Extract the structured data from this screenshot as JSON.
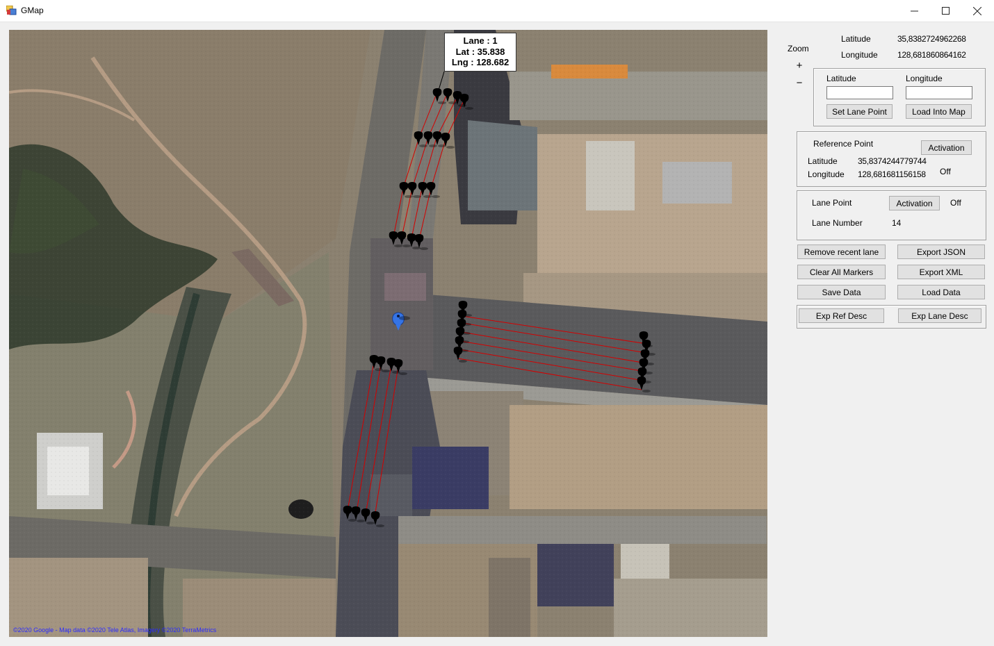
{
  "window": {
    "title": "GMap",
    "minimize_icon": "minimize-icon",
    "maximize_icon": "maximize-icon",
    "close_icon": "close-icon"
  },
  "map": {
    "copyright": "©2020 Google - Map data ©2020 Tele Atlas, Imagery ©2020 TerraMetrics",
    "tooltip": {
      "lane_line": "Lane : 1",
      "lat_line": "Lat : 35.838",
      "lng_line": "Lng : 128.682"
    },
    "marker_color": "#000000",
    "lane_line_color": "#d40000",
    "reference_marker_color": "#2f6fe0"
  },
  "panel": {
    "zoom_label": "Zoom",
    "zoom_in": "+",
    "zoom_out": "−",
    "current": {
      "latitude_label": "Latitude",
      "latitude_value": "35,8382724962268",
      "longitude_label": "Longitude",
      "longitude_value": "128,681860864162"
    },
    "input_group": {
      "latitude_label": "Latitude",
      "latitude_value": "",
      "longitude_label": "Longitude",
      "longitude_value": "",
      "set_lane_point": "Set Lane Point",
      "load_into_map": "Load Into Map"
    },
    "reference": {
      "title": "Reference Point",
      "activation": "Activation",
      "latitude_label": "Latitude",
      "latitude_value": "35,8374244779744",
      "longitude_label": "Longitude",
      "longitude_value": "128,681681156158",
      "status": "Off"
    },
    "lane": {
      "title": "Lane Point",
      "activation": "Activation",
      "status": "Off",
      "number_label": "Lane Number",
      "number_value": "14"
    },
    "buttons": {
      "remove_recent_lane": "Remove recent lane",
      "export_json": "Export JSON",
      "clear_all_markers": "Clear All Markers",
      "export_xml": "Export XML",
      "save_data": "Save Data",
      "load_data": "Load Data",
      "exp_ref_desc": "Exp Ref Desc",
      "exp_lane_desc": "Exp Lane Desc"
    }
  }
}
